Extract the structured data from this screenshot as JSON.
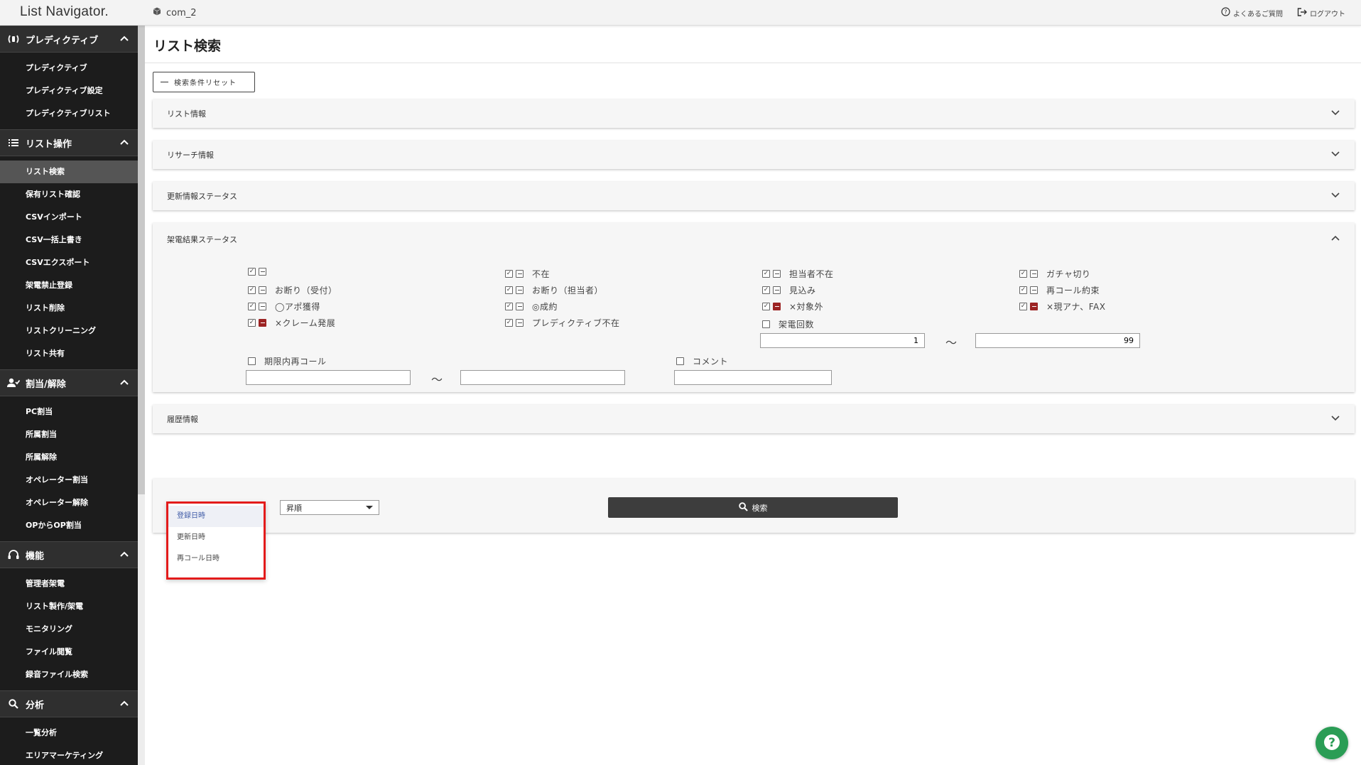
{
  "header": {
    "brand": "List Navigator.",
    "company": "com_2",
    "faq_link": "よくあるご質問",
    "logout_link": "ログアウト"
  },
  "sidebar": {
    "sections": [
      {
        "title": "プレディクティブ",
        "icon": "predictive-icon",
        "items": [
          "プレディクティブ",
          "プレディクティブ設定",
          "プレディクティブリスト"
        ]
      },
      {
        "title": "リスト操作",
        "icon": "list-icon",
        "items": [
          "リスト検索",
          "保有リスト確認",
          "CSVインポート",
          "CSV一括上書き",
          "CSVエクスポート",
          "架電禁止登録",
          "リスト削除",
          "リストクリーニング",
          "リスト共有"
        ],
        "active": "リスト検索"
      },
      {
        "title": "割当/解除",
        "icon": "user-assign-icon",
        "items": [
          "PC割当",
          "所属割当",
          "所属解除",
          "オペレーター割当",
          "オペレーター解除",
          "OPからOP割当"
        ]
      },
      {
        "title": "機能",
        "icon": "headset-icon",
        "items": [
          "管理者架電",
          "リスト製作/架電",
          "モニタリング",
          "ファイル閲覧",
          "録音ファイル検索"
        ]
      },
      {
        "title": "分析",
        "icon": "search-icon",
        "items": [
          "一覧分析",
          "エリアマーケティング"
        ]
      }
    ]
  },
  "main": {
    "title": "リスト検索",
    "reset_button": "検索条件リセット",
    "panels": {
      "list_info": "リスト情報",
      "research_info": "リサーチ情報",
      "update_status": "更新情報ステータス",
      "call_result": "架電結果ステータス",
      "history": "履歴情報"
    },
    "call_result": {
      "col1": [
        "",
        "お断り（受付）",
        "◯アポ獲得",
        "×クレーム発展"
      ],
      "col2": [
        "不在",
        "お断り（担当者）",
        "◎成約",
        "プレディクティブ不在"
      ],
      "col3": [
        "担当者不在",
        "見込み",
        "×対象外"
      ],
      "col4": [
        "ガチャ切り",
        "再コール約束",
        "×現アナ、FAX"
      ],
      "call_count_label": "架電回数",
      "call_count_min": "1",
      "call_count_max": "99",
      "tilde": "〜",
      "recall_label": "期限内再コール",
      "comment_label": "コメント"
    },
    "sort": {
      "order_selected": "昇順",
      "search_button": "検索",
      "dropdown_options": [
        "登録日時",
        "更新日時",
        "再コール日時"
      ],
      "dropdown_selected": "登録日時"
    }
  },
  "colors": {
    "sidebar_bg": "#2f2f2f",
    "highlight_border": "#e31b1b",
    "help_button": "#2a9d55",
    "exclude_checkbox": "#9c2323"
  }
}
